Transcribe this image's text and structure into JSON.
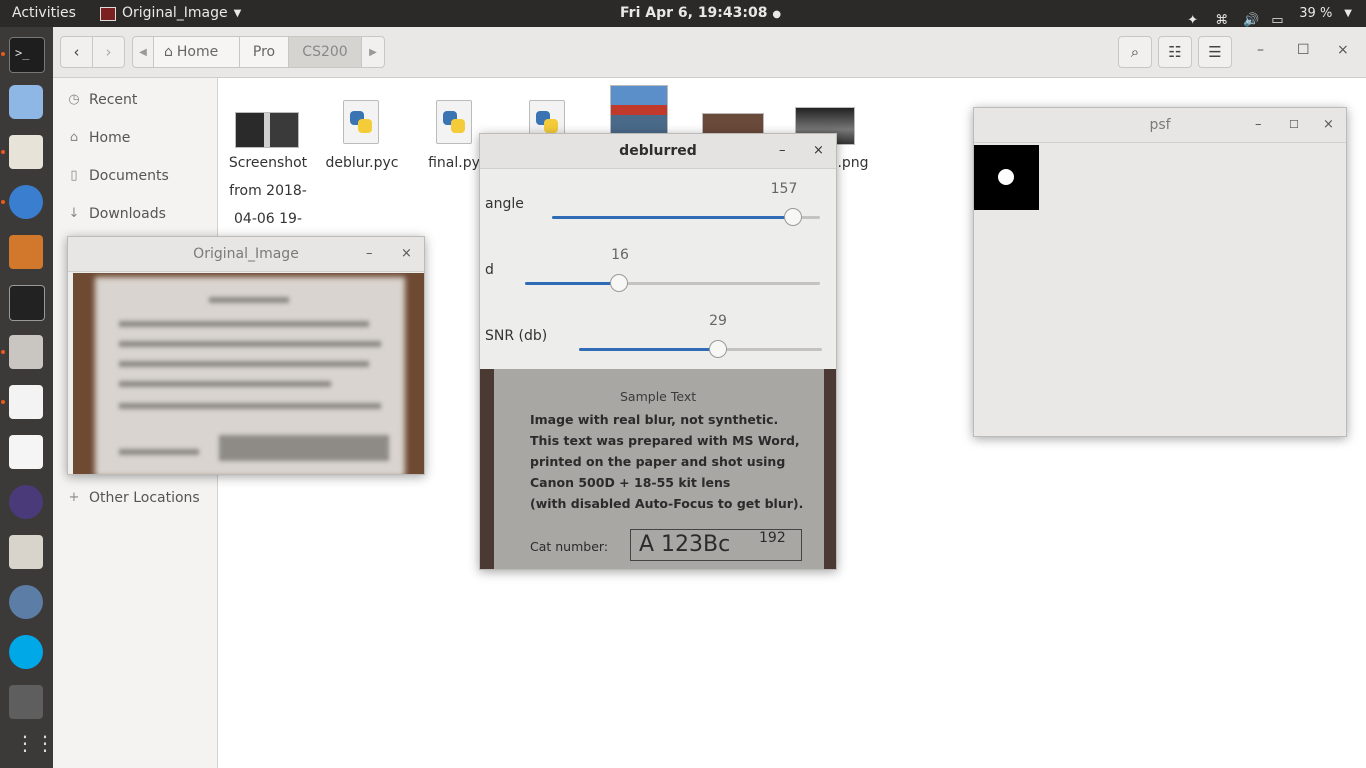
{
  "topbar": {
    "activities": "Activities",
    "app_name": "Original_Image",
    "clock": "Fri Apr  6, 19:43:08",
    "battery": "39 %"
  },
  "nautilus": {
    "breadcrumb": [
      "Home",
      "Pro",
      "CS200"
    ],
    "sidebar": {
      "items": [
        {
          "label": "Recent",
          "icon": "clock-icon"
        },
        {
          "label": "Home",
          "icon": "home-icon"
        },
        {
          "label": "Documents",
          "icon": "document-icon"
        },
        {
          "label": "Downloads",
          "icon": "download-icon"
        }
      ],
      "other_locations": "Other Locations"
    },
    "files": [
      {
        "name": "Screenshot from 2018-04-06 19-",
        "line1": "Screenshot",
        "line2": "from 2018-",
        "line3": "04-06 19-"
      },
      {
        "name": "deblur.pyc"
      },
      {
        "name": "final.py"
      },
      {
        "name": ".png"
      }
    ]
  },
  "windows": {
    "original": {
      "title": "Original_Image"
    },
    "deblurred": {
      "title": "deblurred",
      "sliders": [
        {
          "label": "angle",
          "value": "157",
          "fraction": 0.9
        },
        {
          "label": "d",
          "value": "16",
          "fraction": 0.32
        },
        {
          "label": "SNR (db)",
          "value": "29",
          "fraction": 0.57
        }
      ],
      "image_text": {
        "title": "Sample Text",
        "lines": [
          "Image with real blur, not synthetic.",
          "This text was prepared with MS Word,",
          "printed on the paper and shot using",
          "Canon 500D + 18-55 kit lens",
          "(with disabled Auto-Focus to get blur)."
        ],
        "cat_label": "Cat number:",
        "cat_value": "A 123Bc",
        "cat_suffix": "192"
      }
    },
    "psf": {
      "title": "psf"
    }
  },
  "colors": {
    "accent": "#2f6cb5",
    "topbar": "#2b2a28",
    "dock": "#3b3a38"
  }
}
